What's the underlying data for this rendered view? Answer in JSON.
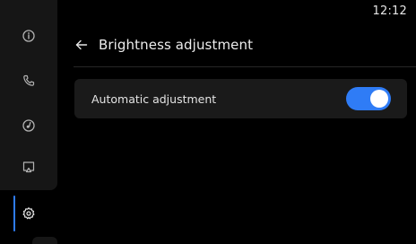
{
  "status_bar": {
    "time": "12:12"
  },
  "sidebar": {
    "items": [
      {
        "name": "info",
        "icon": "info-icon",
        "active": false
      },
      {
        "name": "phone",
        "icon": "phone-icon",
        "active": false
      },
      {
        "name": "music",
        "icon": "music-disc-icon",
        "active": false
      },
      {
        "name": "screen-cast",
        "icon": "screen-cast-icon",
        "active": false
      },
      {
        "name": "settings",
        "icon": "gear-icon",
        "active": true
      }
    ]
  },
  "header": {
    "back_icon": "arrow-left-icon",
    "title": "Brightness adjustment"
  },
  "settings": {
    "automatic_adjustment": {
      "label": "Automatic adjustment",
      "enabled": true
    }
  },
  "colors": {
    "accent": "#2f7cf6",
    "background": "#000000",
    "panel": "#1a1a1a",
    "sidebar": "#161616"
  }
}
